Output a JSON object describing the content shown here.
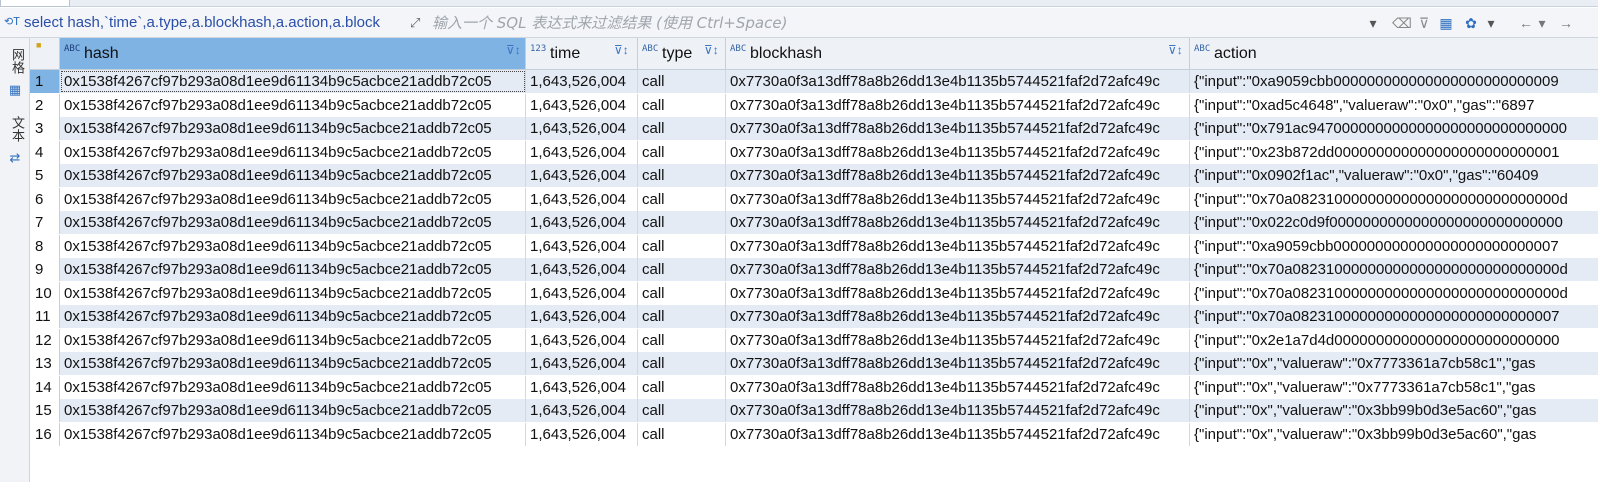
{
  "filter_bar": {
    "sql_query": "select hash,`time`,a.type,a.blockhash,a.action,a.block",
    "placeholder": "输入一个 SQL 表达式来过滤结果 (使用 Ctrl+Space)"
  },
  "side_panel": {
    "grid_label": "网格",
    "text_label": "文本"
  },
  "columns": [
    {
      "type_badge": "ABC",
      "name": "hash"
    },
    {
      "type_badge": "123",
      "name": "time"
    },
    {
      "type_badge": "ABC",
      "name": "type"
    },
    {
      "type_badge": "ABC",
      "name": "blockhash"
    },
    {
      "type_badge": "ABC",
      "name": "action"
    }
  ],
  "rows": [
    {
      "num": "1",
      "hash": "0x1538f4267cf97b293a08d1ee9d61134b9c5acbce21addb72c05",
      "time": "1,643,526,004",
      "type": "call",
      "blockhash": "0x7730a0f3a13dff78a8b26dd13e4b1135b5744521faf2d72afc49c",
      "action": "{\"input\":\"0xa9059cbb000000000000000000000000009"
    },
    {
      "num": "2",
      "hash": "0x1538f4267cf97b293a08d1ee9d61134b9c5acbce21addb72c05",
      "time": "1,643,526,004",
      "type": "call",
      "blockhash": "0x7730a0f3a13dff78a8b26dd13e4b1135b5744521faf2d72afc49c",
      "action": "{\"input\":\"0xad5c4648\",\"valueraw\":\"0x0\",\"gas\":\"6897"
    },
    {
      "num": "3",
      "hash": "0x1538f4267cf97b293a08d1ee9d61134b9c5acbce21addb72c05",
      "time": "1,643,526,004",
      "type": "call",
      "blockhash": "0x7730a0f3a13dff78a8b26dd13e4b1135b5744521faf2d72afc49c",
      "action": "{\"input\":\"0x791ac9470000000000000000000000000000"
    },
    {
      "num": "4",
      "hash": "0x1538f4267cf97b293a08d1ee9d61134b9c5acbce21addb72c05",
      "time": "1,643,526,004",
      "type": "call",
      "blockhash": "0x7730a0f3a13dff78a8b26dd13e4b1135b5744521faf2d72afc49c",
      "action": "{\"input\":\"0x23b872dd000000000000000000000000001"
    },
    {
      "num": "5",
      "hash": "0x1538f4267cf97b293a08d1ee9d61134b9c5acbce21addb72c05",
      "time": "1,643,526,004",
      "type": "call",
      "blockhash": "0x7730a0f3a13dff78a8b26dd13e4b1135b5744521faf2d72afc49c",
      "action": "{\"input\":\"0x0902f1ac\",\"valueraw\":\"0x0\",\"gas\":\"60409"
    },
    {
      "num": "6",
      "hash": "0x1538f4267cf97b293a08d1ee9d61134b9c5acbce21addb72c05",
      "time": "1,643,526,004",
      "type": "call",
      "blockhash": "0x7730a0f3a13dff78a8b26dd13e4b1135b5744521faf2d72afc49c",
      "action": "{\"input\":\"0x70a08231000000000000000000000000000d"
    },
    {
      "num": "7",
      "hash": "0x1538f4267cf97b293a08d1ee9d61134b9c5acbce21addb72c05",
      "time": "1,643,526,004",
      "type": "call",
      "blockhash": "0x7730a0f3a13dff78a8b26dd13e4b1135b5744521faf2d72afc49c",
      "action": "{\"input\":\"0x022c0d9f0000000000000000000000000000"
    },
    {
      "num": "8",
      "hash": "0x1538f4267cf97b293a08d1ee9d61134b9c5acbce21addb72c05",
      "time": "1,643,526,004",
      "type": "call",
      "blockhash": "0x7730a0f3a13dff78a8b26dd13e4b1135b5744521faf2d72afc49c",
      "action": "{\"input\":\"0xa9059cbb000000000000000000000000007"
    },
    {
      "num": "9",
      "hash": "0x1538f4267cf97b293a08d1ee9d61134b9c5acbce21addb72c05",
      "time": "1,643,526,004",
      "type": "call",
      "blockhash": "0x7730a0f3a13dff78a8b26dd13e4b1135b5744521faf2d72afc49c",
      "action": "{\"input\":\"0x70a08231000000000000000000000000000d"
    },
    {
      "num": "10",
      "hash": "0x1538f4267cf97b293a08d1ee9d61134b9c5acbce21addb72c05",
      "time": "1,643,526,004",
      "type": "call",
      "blockhash": "0x7730a0f3a13dff78a8b26dd13e4b1135b5744521faf2d72afc49c",
      "action": "{\"input\":\"0x70a08231000000000000000000000000000d"
    },
    {
      "num": "11",
      "hash": "0x1538f4267cf97b293a08d1ee9d61134b9c5acbce21addb72c05",
      "time": "1,643,526,004",
      "type": "call",
      "blockhash": "0x7730a0f3a13dff78a8b26dd13e4b1135b5744521faf2d72afc49c",
      "action": "{\"input\":\"0x70a08231000000000000000000000000007"
    },
    {
      "num": "12",
      "hash": "0x1538f4267cf97b293a08d1ee9d61134b9c5acbce21addb72c05",
      "time": "1,643,526,004",
      "type": "call",
      "blockhash": "0x7730a0f3a13dff78a8b26dd13e4b1135b5744521faf2d72afc49c",
      "action": "{\"input\":\"0x2e1a7d4d000000000000000000000000000"
    },
    {
      "num": "13",
      "hash": "0x1538f4267cf97b293a08d1ee9d61134b9c5acbce21addb72c05",
      "time": "1,643,526,004",
      "type": "call",
      "blockhash": "0x7730a0f3a13dff78a8b26dd13e4b1135b5744521faf2d72afc49c",
      "action": "{\"input\":\"0x\",\"valueraw\":\"0x7773361a7cb58c1\",\"gas"
    },
    {
      "num": "14",
      "hash": "0x1538f4267cf97b293a08d1ee9d61134b9c5acbce21addb72c05",
      "time": "1,643,526,004",
      "type": "call",
      "blockhash": "0x7730a0f3a13dff78a8b26dd13e4b1135b5744521faf2d72afc49c",
      "action": "{\"input\":\"0x\",\"valueraw\":\"0x7773361a7cb58c1\",\"gas"
    },
    {
      "num": "15",
      "hash": "0x1538f4267cf97b293a08d1ee9d61134b9c5acbce21addb72c05",
      "time": "1,643,526,004",
      "type": "call",
      "blockhash": "0x7730a0f3a13dff78a8b26dd13e4b1135b5744521faf2d72afc49c",
      "action": "{\"input\":\"0x\",\"valueraw\":\"0x3bb99b0d3e5ac60\",\"gas"
    },
    {
      "num": "16",
      "hash": "0x1538f4267cf97b293a08d1ee9d61134b9c5acbce21addb72c05",
      "time": "1,643,526,004",
      "type": "call",
      "blockhash": "0x7730a0f3a13dff78a8b26dd13e4b1135b5744521faf2d72afc49c",
      "action": "{\"input\":\"0x\",\"valueraw\":\"0x3bb99b0d3e5ac60\",\"gas"
    }
  ],
  "colors": {
    "selected_header": "#7eb3e3",
    "alt_row": "#e4ebf5",
    "sql_text": "#2a4fa8"
  }
}
